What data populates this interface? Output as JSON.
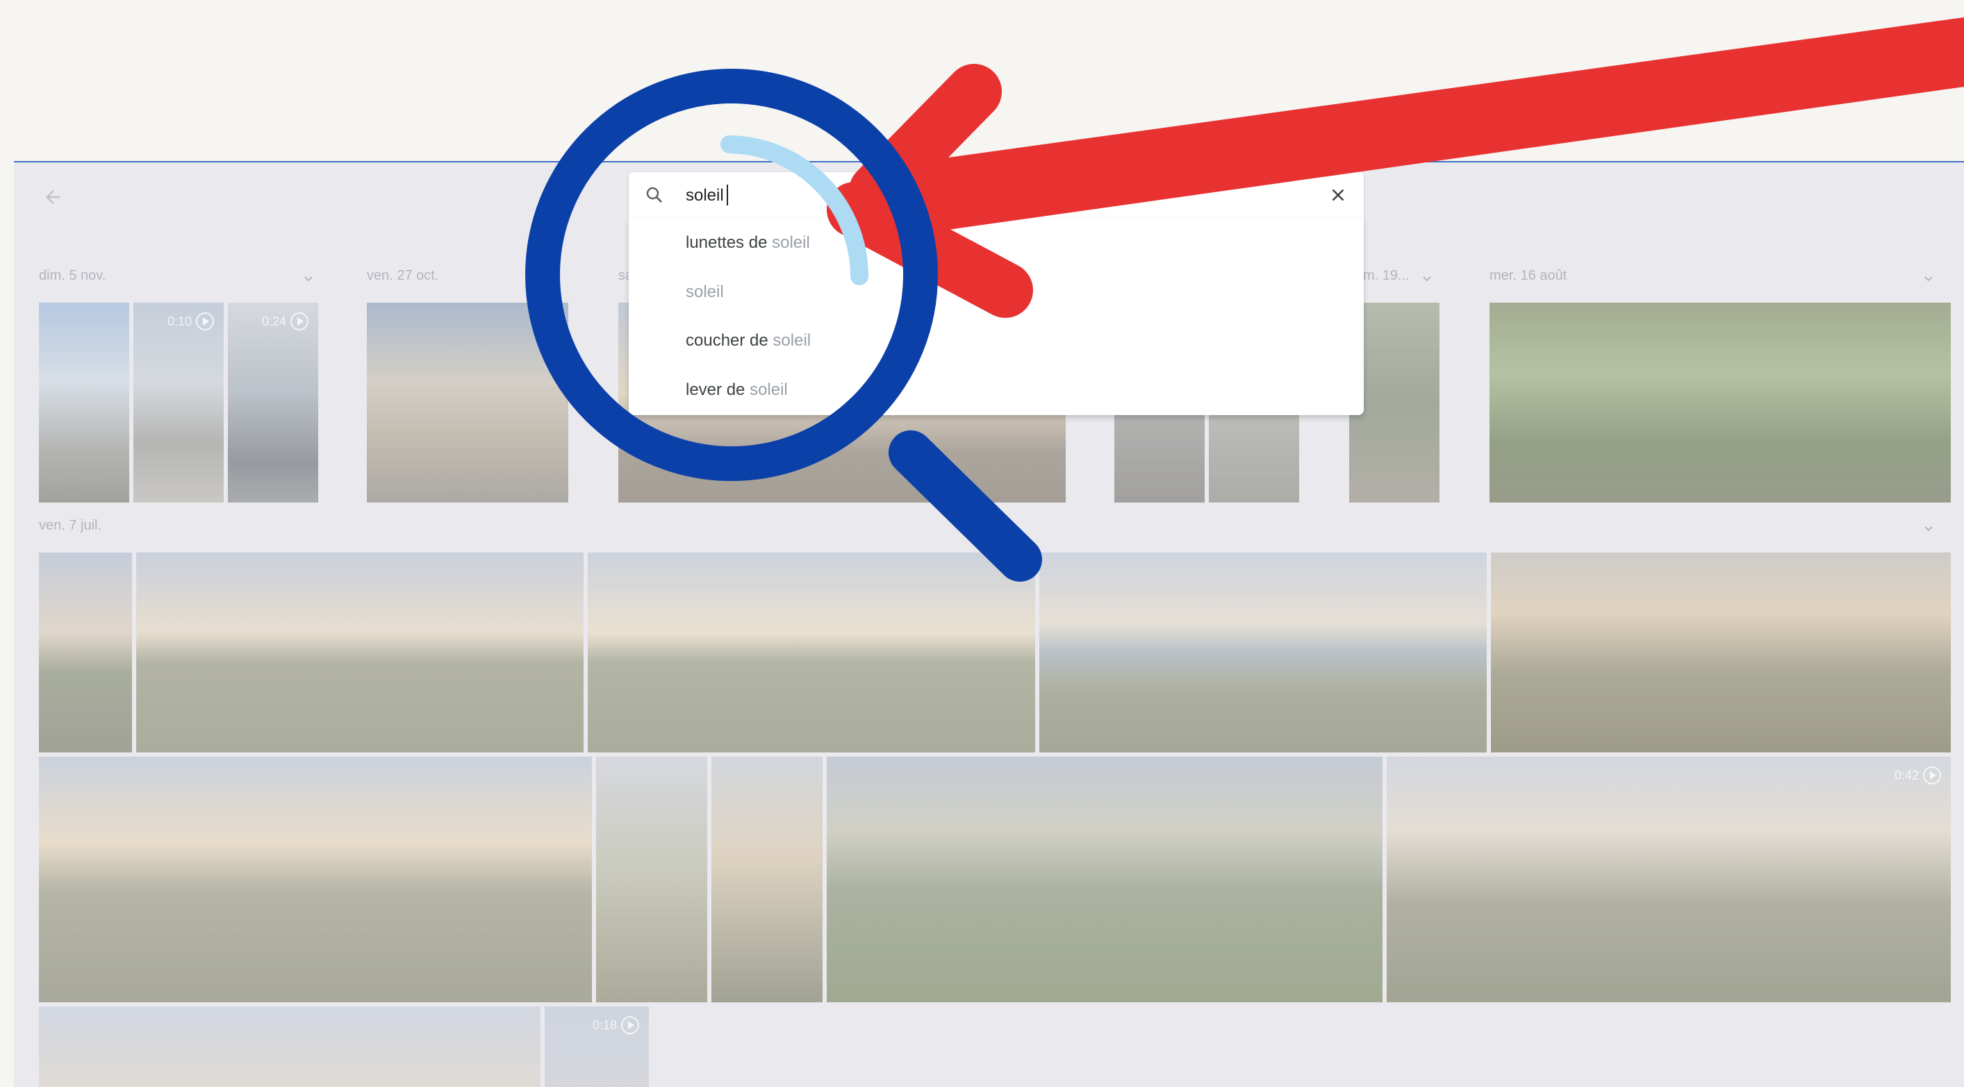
{
  "search": {
    "value": "soleil",
    "suggestions": [
      {
        "prefix": "lunettes de ",
        "match": "soleil"
      },
      {
        "prefix": "",
        "match": "soleil"
      },
      {
        "prefix": "coucher de ",
        "match": "soleil"
      },
      {
        "prefix": "lever de ",
        "match": "soleil"
      }
    ]
  },
  "groups": [
    {
      "label": "dim. 5 nov."
    },
    {
      "label": "ven. 27 oct."
    },
    {
      "label": "sa"
    },
    {
      "label": "m. 19..."
    },
    {
      "label": "mer. 16 août"
    },
    {
      "label": "ven. 7 juil."
    }
  ],
  "videos": {
    "v1": "0:10",
    "v2": "0:24",
    "v3": "0:42",
    "v4": "0:18"
  },
  "icons": {
    "back": "arrow-back-icon",
    "search": "search-icon",
    "clear": "close-icon",
    "expand": "chevron-down-icon",
    "play": "play-circle-icon",
    "magnifier": "magnifying-glass-icon",
    "arrow": "red-arrow-icon"
  },
  "colors": {
    "arrow_red": "#e83232",
    "magnifier_blue": "#0b40a8",
    "lens_highlight": "#aedbf4",
    "accent_line": "#3b6fc4"
  }
}
